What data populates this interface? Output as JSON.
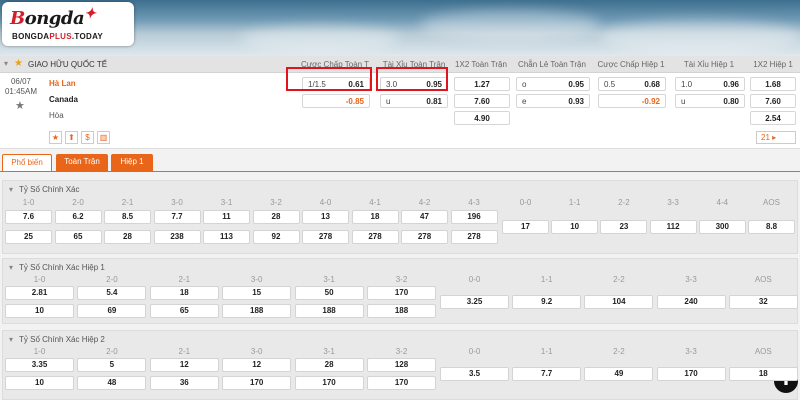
{
  "logo": {
    "main_b": "B",
    "main_rest": "ongda",
    "star": "✦",
    "sub_a": "BONGDA",
    "sub_b": "PLUS",
    "sub_c": ".TODAY"
  },
  "league": {
    "name": "GIAO HỮU QUỐC TẾ",
    "star_icon": "star-icon"
  },
  "column_headers": [
    "Cược Chấp Toàn T",
    "Tài Xỉu Toàn Trận",
    "1X2 Toàn Trận",
    "Chẵn Lẻ Toàn Trận",
    "Cược Chấp Hiệp 1",
    "Tài Xỉu Hiệp 1",
    "1X2 Hiệp 1"
  ],
  "match": {
    "date": "06/07",
    "time": "01:45AM",
    "home": "Hà Lan",
    "away": "Canada",
    "draw": "Hòa",
    "hdp_ft": {
      "line": "1/1.5",
      "home": "0.61",
      "away": "-0.85"
    },
    "ou_ft": {
      "line": "3.0",
      "over": "0.95",
      "under_label": "u",
      "under": "0.81"
    },
    "x12_ft": {
      "home": "1.27",
      "away": "7.60",
      "draw": "4.90"
    },
    "oe_ft": {
      "odd_label": "o",
      "odd": "0.95",
      "even_label": "e",
      "even": "0.93"
    },
    "hdp_h1": {
      "line": "0.5",
      "home": "0.68",
      "away": "-0.92"
    },
    "ou_h1": {
      "line": "1.0",
      "over": "0.96",
      "under_label": "u",
      "under": "0.80"
    },
    "x12_h1": {
      "home": "1.68",
      "away": "7.60",
      "draw": "2.54"
    },
    "more_label": "21 ▸",
    "icons": [
      "★",
      "⬆",
      "$",
      "▥"
    ]
  },
  "tabs": [
    {
      "label": "Phổ biến"
    },
    {
      "label": "Toàn Trận"
    },
    {
      "label": "Hiệp 1"
    }
  ],
  "sections": [
    {
      "title": "Tỷ Số Chính Xác",
      "labels": [
        "1-0",
        "2-0",
        "2-1",
        "3-0",
        "3-1",
        "3-2",
        "4-0",
        "4-1",
        "4-2",
        "4-3",
        "0-0",
        "1-1",
        "2-2",
        "3-3",
        "4-4",
        "AOS"
      ],
      "row1": [
        "7.6",
        "6.2",
        "8.5",
        "7.7",
        "11",
        "28",
        "13",
        "18",
        "47",
        "196"
      ],
      "row2": [
        "25",
        "65",
        "28",
        "238",
        "113",
        "92",
        "278",
        "278",
        "278",
        "278"
      ],
      "draws": [
        "17",
        "10",
        "23",
        "112",
        "300",
        "8.8"
      ]
    },
    {
      "title": "Tỷ Số Chính Xác Hiệp 1",
      "labels": [
        "1-0",
        "2-0",
        "2-1",
        "3-0",
        "3-1",
        "3-2",
        "0-0",
        "1-1",
        "2-2",
        "3-3",
        "AOS"
      ],
      "row1": [
        "2.81",
        "5.4",
        "18",
        "15",
        "50",
        "170"
      ],
      "row2": [
        "10",
        "69",
        "65",
        "188",
        "188",
        "188"
      ],
      "draws": [
        "3.25",
        "9.2",
        "104",
        "240",
        "32"
      ]
    },
    {
      "title": "Tỷ Số Chính Xác Hiệp 2",
      "labels": [
        "1-0",
        "2-0",
        "2-1",
        "3-0",
        "3-1",
        "3-2",
        "0-0",
        "1-1",
        "2-2",
        "3-3",
        "AOS"
      ],
      "row1": [
        "3.35",
        "5",
        "12",
        "12",
        "28",
        "128"
      ],
      "row2": [
        "10",
        "48",
        "36",
        "170",
        "170",
        "170"
      ],
      "draws": [
        "3.5",
        "7.7",
        "49",
        "170",
        "18"
      ]
    }
  ],
  "fab_icon": "scroll-top-icon",
  "colors": {
    "accent": "#e8651a",
    "highlight": "#e0141e"
  }
}
